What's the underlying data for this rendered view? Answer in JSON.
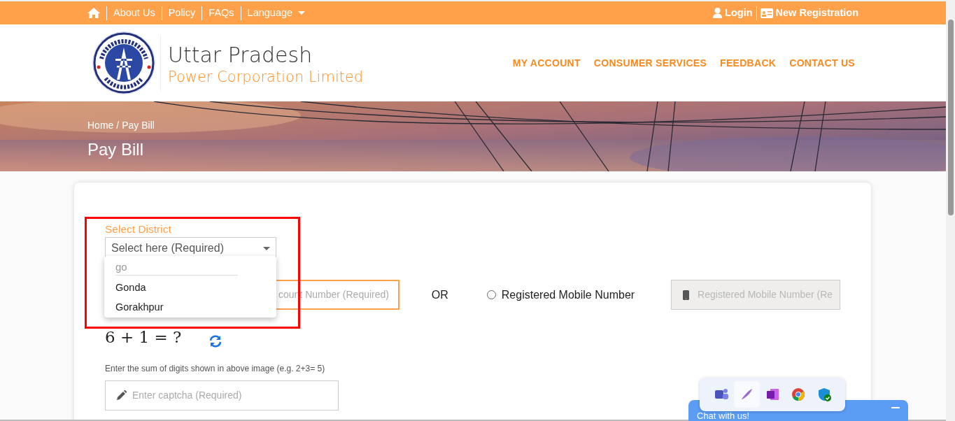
{
  "top_bar": {
    "links": [
      "About Us",
      "Policy",
      "FAQs"
    ],
    "language": "Language",
    "login": "Login",
    "register": "New Registration"
  },
  "header": {
    "title": "Uttar Pradesh",
    "subtitle": "Power Corporation Limited",
    "nav": [
      "MY ACCOUNT",
      "CONSUMER SERVICES",
      "FEEDBACK",
      "CONTACT US"
    ]
  },
  "banner": {
    "breadcrumb": [
      "Home",
      "Pay Bill"
    ],
    "separator": "/",
    "title": "Pay Bill"
  },
  "form": {
    "district_label": "Select District",
    "district_select": {
      "placeholder": "Select here (Required)",
      "expanded": true
    },
    "dropdown": {
      "search": "go",
      "options": [
        {
          "label": "Gonda",
          "selected": false
        },
        {
          "label": "Gorakhpur",
          "selected": false
        }
      ]
    },
    "account_field": {
      "placeholder": "count Number (Required)"
    },
    "or_text": "OR",
    "mobile_option": {
      "label": "Registered Mobile Number",
      "selected": false
    },
    "mobile_field": {
      "placeholder": "Registered Mobile Number (Re",
      "disabled": true
    },
    "captcha": "6 + 1 = ?",
    "captcha_hint": "Enter the sum of digits shown in above image (e.g. 2+3= 5)",
    "captcha_field": {
      "placeholder": "Enter captcha (Required)"
    }
  },
  "chat": {
    "label": "Chat with us!"
  }
}
